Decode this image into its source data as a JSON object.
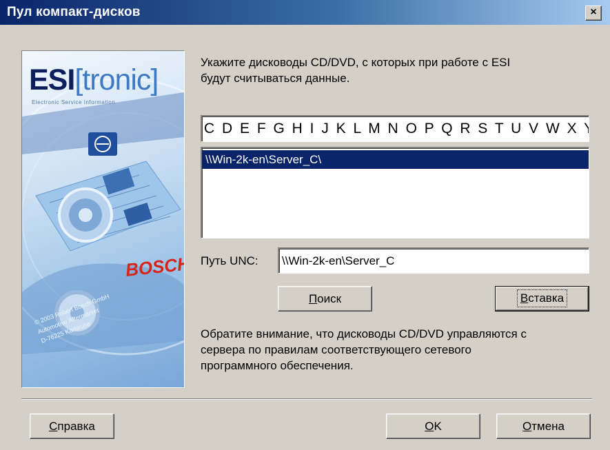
{
  "window": {
    "title": "Пул компакт-дисков",
    "close_symbol": "×"
  },
  "image": {
    "brand": "ESI",
    "brand_suffix": "[tronic]",
    "subtitle": "Electronic Service Information",
    "maker": "BOSCH",
    "copyright_lines": [
      "© 2003 Robert Bosch GmbH",
      "Automotive Aftermarket",
      "D-76225 Karlsruhe"
    ]
  },
  "instructions": {
    "line1": "Укажите дисководы CD/DVD, с которых при работе с ESI",
    "line2": "будут считываться данные."
  },
  "drive_letters": "C D E F G H I J K L M N O P Q R S T U V W X Y Z",
  "drive_list": {
    "items": [
      "\\\\Win-2k-en\\Server_C\\"
    ],
    "selected_index": 0
  },
  "unc": {
    "label": "Путь UNC:",
    "value": "\\\\Win-2k-en\\Server_C"
  },
  "buttons": {
    "search_underlined": "П",
    "search_rest": "оиск",
    "insert_underlined": "В",
    "insert_rest": "ставка",
    "help_underlined": "С",
    "help_rest": "правка",
    "ok_underlined": "O",
    "ok_rest": "K",
    "cancel_underlined": "О",
    "cancel_rest": "тмена"
  },
  "note": {
    "line1": "Обратите внимание, что дисководы CD/DVD управляются с",
    "line2": "сервера по правилам соответствующего сетевого",
    "line3": "программного обеспечения."
  },
  "colors": {
    "title_bar": "#0a246a",
    "selection": "#0a246a",
    "dialog_face": "#d4d0c8",
    "bosch_red": "#d8251c"
  }
}
